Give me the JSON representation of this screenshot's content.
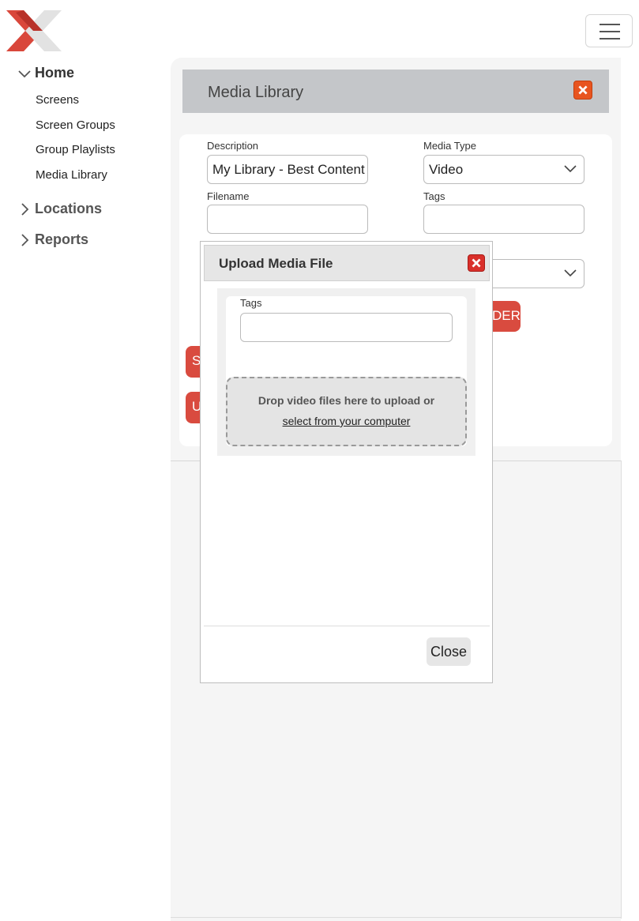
{
  "nav": {
    "home": "Home",
    "items": [
      "Screens",
      "Screen Groups",
      "Group Playlists",
      "Media Library"
    ],
    "locations": "Locations",
    "reports": "Reports"
  },
  "icons": {
    "logo": "x-logo-icon",
    "menu": "hamburger-menu-icon",
    "close": "close-icon",
    "chevron_down": "chevron-down-icon",
    "chevron_right": "chevron-right-icon"
  },
  "colors": {
    "accent_red": "#d94b3f",
    "close_orange": "#e8541f",
    "header_gray": "#c4c6c9"
  },
  "panel": {
    "title": "Media Library"
  },
  "form": {
    "description_label": "Description",
    "description_value": "My Library - Best Content",
    "media_type_label": "Media Type",
    "media_type_value": "Video",
    "filename_label": "Filename",
    "filename_value": "",
    "tags_label": "Tags",
    "tags_value": "",
    "partial_button_1": "DER",
    "partial_button_2": "S",
    "partial_button_3": "U"
  },
  "modal": {
    "title": "Upload Media File",
    "tags_label": "Tags",
    "tags_value": "",
    "drop_text": "Drop video files here to upload or",
    "select_link": "select from your computer",
    "close_label": "Close"
  }
}
